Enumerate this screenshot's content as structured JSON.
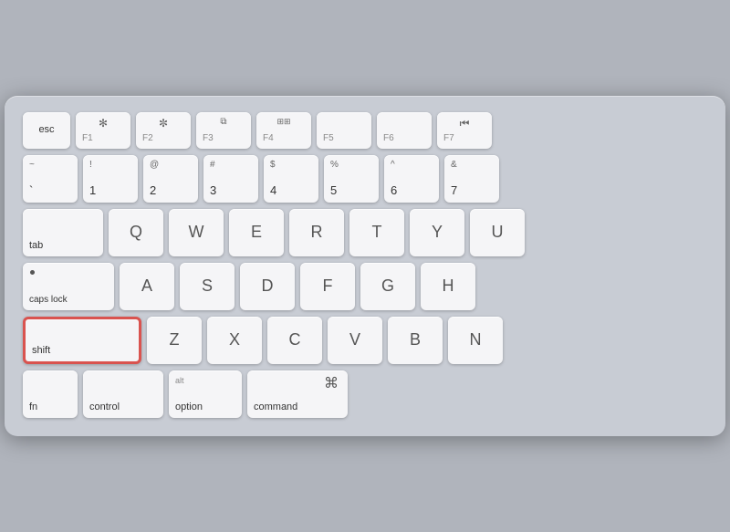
{
  "keyboard": {
    "rows": [
      {
        "id": "fn-row",
        "keys": [
          {
            "id": "esc",
            "label": "esc",
            "type": "esc"
          },
          {
            "id": "f1",
            "label": "F1",
            "icon": "☀",
            "type": "fn"
          },
          {
            "id": "f2",
            "label": "F2",
            "icon": "☀",
            "type": "fn"
          },
          {
            "id": "f3",
            "label": "F3",
            "icon": "⊞",
            "type": "fn"
          },
          {
            "id": "f4",
            "label": "F4",
            "icon": "⊞⊞",
            "type": "fn"
          },
          {
            "id": "f5",
            "label": "F5",
            "type": "fn"
          },
          {
            "id": "f6",
            "label": "F6",
            "type": "fn"
          },
          {
            "id": "f7",
            "label": "F7",
            "icon": "⏮",
            "type": "fn"
          }
        ]
      },
      {
        "id": "number-row",
        "keys": [
          {
            "id": "tilde",
            "top": "~",
            "main": "`"
          },
          {
            "id": "1",
            "top": "!",
            "main": "1"
          },
          {
            "id": "2",
            "top": "@",
            "main": "2"
          },
          {
            "id": "3",
            "top": "#",
            "main": "3"
          },
          {
            "id": "4",
            "top": "$",
            "main": "4"
          },
          {
            "id": "5",
            "top": "%",
            "main": "5"
          },
          {
            "id": "6",
            "top": "^",
            "main": "6"
          },
          {
            "id": "7",
            "top": "&",
            "main": "7"
          }
        ]
      },
      {
        "id": "qwerty-row",
        "keys": [
          {
            "id": "tab",
            "label": "tab"
          },
          {
            "id": "q",
            "label": "Q"
          },
          {
            "id": "w",
            "label": "W"
          },
          {
            "id": "e",
            "label": "E"
          },
          {
            "id": "r",
            "label": "R"
          },
          {
            "id": "t",
            "label": "T"
          },
          {
            "id": "y",
            "label": "Y"
          },
          {
            "id": "u",
            "label": "U"
          }
        ]
      },
      {
        "id": "asdf-row",
        "keys": [
          {
            "id": "caps",
            "label": "caps lock"
          },
          {
            "id": "a",
            "label": "A"
          },
          {
            "id": "s",
            "label": "S"
          },
          {
            "id": "d",
            "label": "D"
          },
          {
            "id": "f",
            "label": "F"
          },
          {
            "id": "g",
            "label": "G"
          },
          {
            "id": "h",
            "label": "H"
          }
        ]
      },
      {
        "id": "zxcv-row",
        "keys": [
          {
            "id": "shift-left",
            "label": "shift",
            "highlighted": true
          },
          {
            "id": "z",
            "label": "Z"
          },
          {
            "id": "x",
            "label": "X"
          },
          {
            "id": "c",
            "label": "C"
          },
          {
            "id": "v",
            "label": "V"
          },
          {
            "id": "b",
            "label": "B"
          },
          {
            "id": "n",
            "label": "N"
          }
        ]
      },
      {
        "id": "bottom-row",
        "keys": [
          {
            "id": "fn",
            "label": "fn"
          },
          {
            "id": "control",
            "label": "control"
          },
          {
            "id": "option",
            "label": "option",
            "top": "alt"
          },
          {
            "id": "command",
            "label": "command",
            "symbol": "⌘"
          }
        ]
      }
    ]
  }
}
